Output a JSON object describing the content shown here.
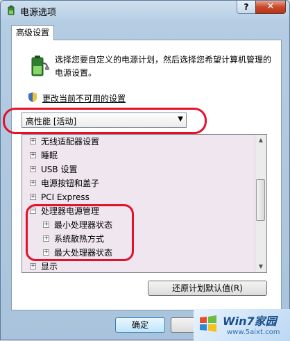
{
  "window": {
    "title": "电源选项",
    "help_label": "?",
    "close_label": "✕"
  },
  "tabs": [
    {
      "label": "高级设置"
    }
  ],
  "description": "选择您要自定义的电源计划，然后选择您希望计算机管理的电源设置。",
  "change_settings_link": "更改当前不可用的设置",
  "plan_select": {
    "value": "高性能 [活动]"
  },
  "tree": {
    "items": [
      {
        "label": "无线适配器设置",
        "level": 0,
        "expanded": false
      },
      {
        "label": "睡眠",
        "level": 0,
        "expanded": false
      },
      {
        "label": "USB 设置",
        "level": 0,
        "expanded": false
      },
      {
        "label": "电源按钮和盖子",
        "level": 0,
        "expanded": false
      },
      {
        "label": "PCI Express",
        "level": 0,
        "expanded": false
      },
      {
        "label": "处理器电源管理",
        "level": 0,
        "expanded": true
      },
      {
        "label": "最小处理器状态",
        "level": 1,
        "expanded": false
      },
      {
        "label": "系统散热方式",
        "level": 1,
        "expanded": false
      },
      {
        "label": "最大处理器状态",
        "level": 1,
        "expanded": false
      },
      {
        "label": "显示",
        "level": 0,
        "expanded": false
      }
    ]
  },
  "buttons": {
    "restore": "还原计划默认值(R)",
    "ok": "确定"
  },
  "watermark": {
    "title": "Win7家园",
    "url": "www.5aixt.com"
  },
  "colors": {
    "annotation": "#e4102a",
    "tree_background": "#efe6ef"
  }
}
